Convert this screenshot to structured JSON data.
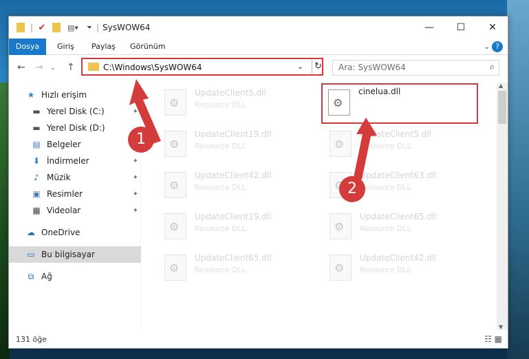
{
  "window": {
    "title": "SysWOW64",
    "minimize_icon": "minimize-icon",
    "maximize_icon": "maximize-icon",
    "close_icon": "close-icon"
  },
  "ribbon": {
    "tabs": [
      "Dosya",
      "Giriş",
      "Paylaş",
      "Görünüm"
    ],
    "help": "?"
  },
  "navigation": {
    "address": "C:\\Windows\\SysWOW64",
    "search_placeholder": "Ara: SysWOW64"
  },
  "sidebar": {
    "items": [
      {
        "label": "Hızlı erişim",
        "icon": "star-icon"
      },
      {
        "label": "Yerel Disk (C:)",
        "icon": "drive-icon"
      },
      {
        "label": "Yerel Disk (D:)",
        "icon": "drive-icon"
      },
      {
        "label": "Belgeler",
        "icon": "documents-icon"
      },
      {
        "label": "İndirmeler",
        "icon": "download-icon"
      },
      {
        "label": "Müzik",
        "icon": "music-icon"
      },
      {
        "label": "Resimler",
        "icon": "pictures-icon"
      },
      {
        "label": "Videolar",
        "icon": "videos-icon"
      },
      {
        "label": "OneDrive",
        "icon": "cloud-icon"
      },
      {
        "label": "Bu bilgisayar",
        "icon": "computer-icon"
      },
      {
        "label": "Ağ",
        "icon": "network-icon"
      }
    ]
  },
  "files": [
    {
      "name": "UpdateClient5.dll",
      "desc": "Resource DLL"
    },
    {
      "name": "cinelua.dll",
      "desc": ""
    },
    {
      "name": "UpdateClient19.dll",
      "desc": "Resource DLL"
    },
    {
      "name": "UpdateClient5.dll",
      "desc": "Resource DLL"
    },
    {
      "name": "UpdateClient42.dll",
      "desc": "Resource DLL"
    },
    {
      "name": "UpdateClient63.dll",
      "desc": "Resource DLL"
    },
    {
      "name": "UpdateClient19.dll",
      "desc": "Resource DLL"
    },
    {
      "name": "UpdateClient65.dll",
      "desc": "Resource DLL"
    },
    {
      "name": "UpdateClient65.dll",
      "desc": "Resource DLL"
    },
    {
      "name": "UpdateClient42.dll",
      "desc": "Resource DLL"
    }
  ],
  "status": {
    "item_count": "131 öğe"
  },
  "annotations": {
    "badge1": "1",
    "badge2": "2"
  },
  "colors": {
    "accent": "#1979ca",
    "highlight": "#d9363e"
  }
}
